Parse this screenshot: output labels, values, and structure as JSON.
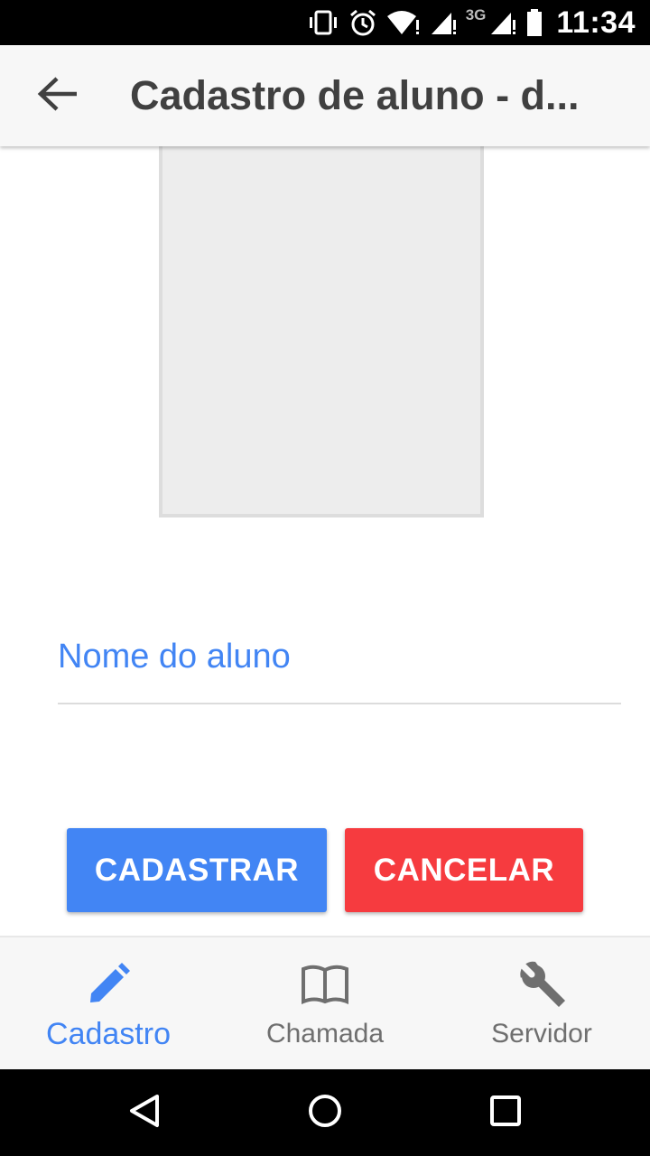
{
  "status_bar": {
    "network_label": "3G",
    "time": "11:34",
    "icons": [
      "vibrate-icon",
      "alarm-icon",
      "wifi-icon",
      "signal-icon",
      "signal-icon",
      "battery-icon"
    ]
  },
  "app_bar": {
    "title": "Cadastro de aluno - d...",
    "back_icon": "arrow-back-icon"
  },
  "form": {
    "name_placeholder": "Nome do aluno",
    "name_value": "",
    "save_label": "CADASTRAR",
    "cancel_label": "CANCELAR"
  },
  "bottom_nav": {
    "items": [
      {
        "label": "Cadastro",
        "icon": "pencil-icon",
        "active": true
      },
      {
        "label": "Chamada",
        "icon": "book-icon",
        "active": false
      },
      {
        "label": "Servidor",
        "icon": "wrench-icon",
        "active": false
      }
    ]
  },
  "system_nav": {
    "icons": [
      "back-triangle-icon",
      "home-circle-icon",
      "recents-square-icon"
    ]
  },
  "colors": {
    "accent": "#4285f4",
    "cancel": "#f63b3f",
    "app_bar": "#f7f7f7",
    "title_text": "#404040",
    "nav_inactive": "#6f6f6f"
  }
}
